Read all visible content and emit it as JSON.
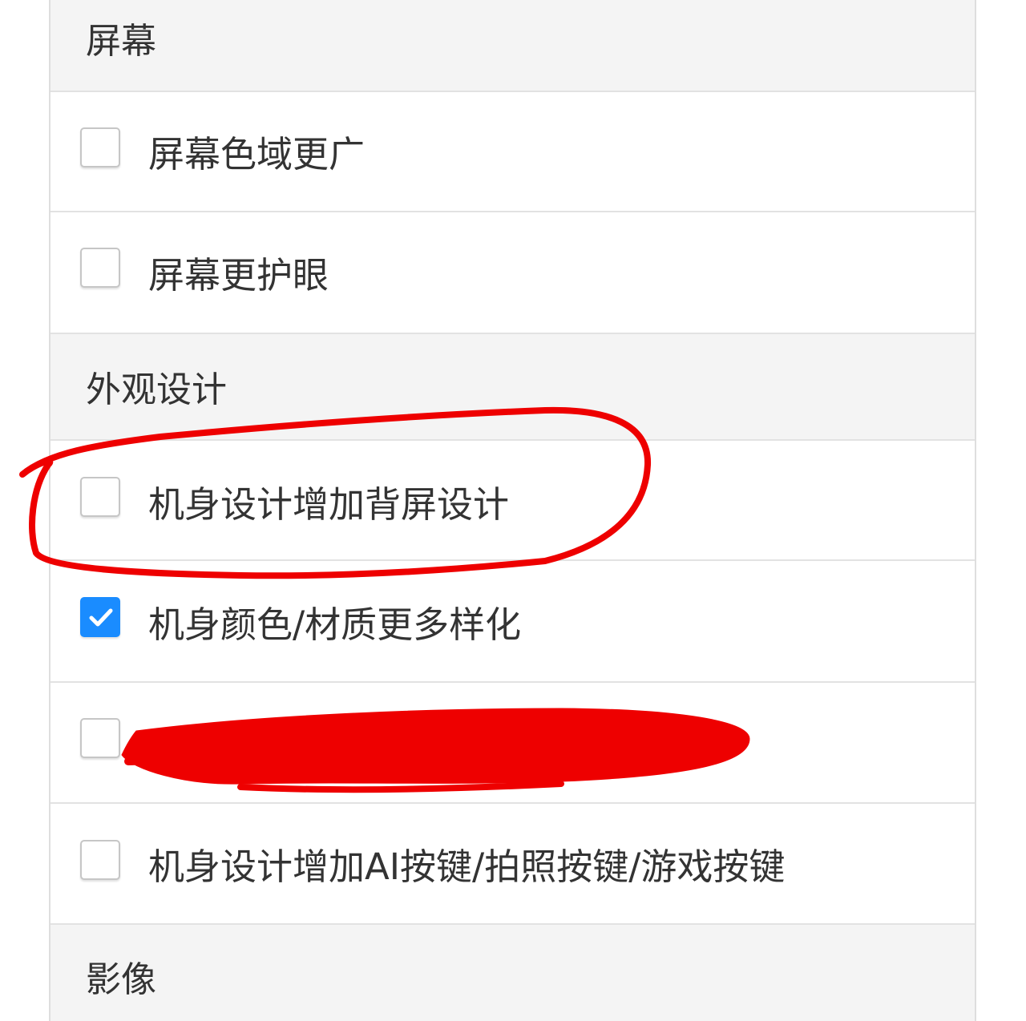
{
  "sections": [
    {
      "title": "屏幕",
      "options": [
        {
          "label": "屏幕色域更广",
          "checked": false
        },
        {
          "label": "屏幕更护眼",
          "checked": false
        }
      ]
    },
    {
      "title": "外观设计",
      "options": [
        {
          "label": "机身设计增加背屏设计",
          "checked": false
        },
        {
          "label": "机身颜色/材质更多样化",
          "checked": true
        },
        {
          "label": "",
          "checked": false,
          "redacted": true
        },
        {
          "label": "机身设计增加AI按键/拍照按键/游戏按键",
          "checked": false
        }
      ]
    },
    {
      "title": "影像",
      "options": []
    }
  ],
  "annotations": {
    "stroke_color": "#ee0000",
    "circled_option": "机身设计增加背屏设计"
  }
}
